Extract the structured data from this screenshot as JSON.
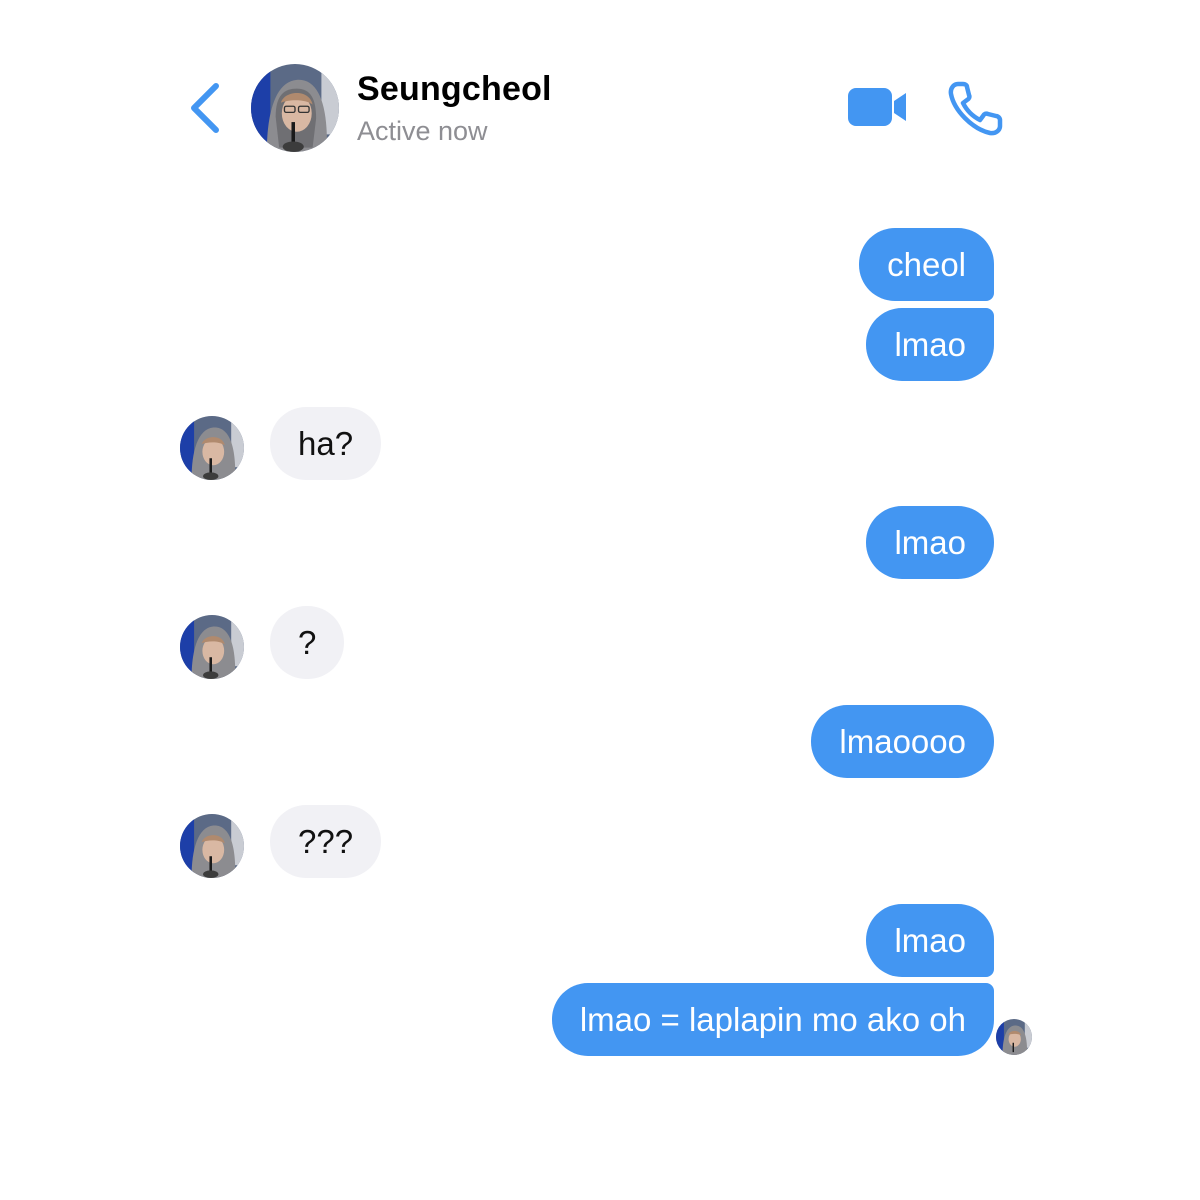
{
  "header": {
    "contact_name": "Seungcheol",
    "status": "Active now",
    "back_icon": "chevron-left-icon",
    "video_icon": "video-camera-icon",
    "call_icon": "phone-icon",
    "accent_color": "#4396f2"
  },
  "messages": [
    {
      "sender": "me",
      "text": "cheol"
    },
    {
      "sender": "me",
      "text": "lmao"
    },
    {
      "sender": "contact",
      "text": "ha?"
    },
    {
      "sender": "me",
      "text": "lmao"
    },
    {
      "sender": "contact",
      "text": "?"
    },
    {
      "sender": "me",
      "text": "lmaoooo"
    },
    {
      "sender": "contact",
      "text": "???"
    },
    {
      "sender": "me",
      "text": "lmao"
    },
    {
      "sender": "me",
      "text": "lmao = laplapin mo ako oh"
    }
  ],
  "colors": {
    "outgoing_bubble": "#4396f2",
    "incoming_bubble": "#f1f1f5",
    "status_text": "#8e8e93"
  }
}
